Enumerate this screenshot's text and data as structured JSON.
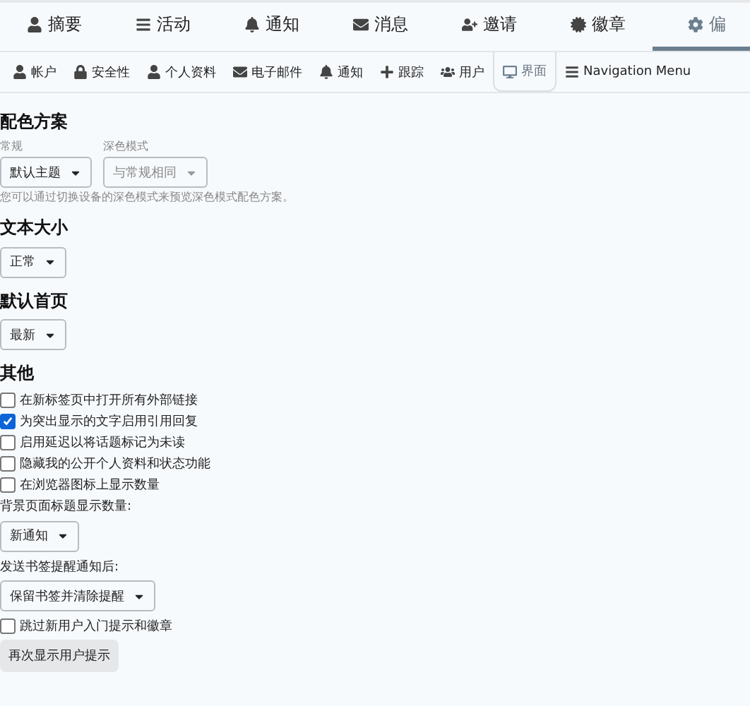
{
  "main_tabs": [
    {
      "label": "摘要",
      "selected": false
    },
    {
      "label": "活动",
      "selected": false
    },
    {
      "label": "通知",
      "selected": false
    },
    {
      "label": "消息",
      "selected": false
    },
    {
      "label": "邀请",
      "selected": false
    },
    {
      "label": "徽章",
      "selected": false
    },
    {
      "label": "偏",
      "selected": true
    }
  ],
  "sub_tabs": [
    {
      "label": "帐户",
      "selected": false
    },
    {
      "label": "安全性",
      "selected": false
    },
    {
      "label": "个人资料",
      "selected": false
    },
    {
      "label": "电子邮件",
      "selected": false
    },
    {
      "label": "通知",
      "selected": false
    },
    {
      "label": "跟踪",
      "selected": false
    },
    {
      "label": "用户",
      "selected": false
    },
    {
      "label": "界面",
      "selected": true
    },
    {
      "label": "Navigation Menu",
      "selected": false
    }
  ],
  "color_scheme": {
    "heading": "配色方案",
    "selects": [
      {
        "label": "常规",
        "value": "默认主题",
        "disabled": false
      },
      {
        "label": "深色模式",
        "value": "与常规相同",
        "disabled": true
      }
    ],
    "note": "您可以通过切换设备的深色模式来预览深色模式配色方案。"
  },
  "text_size": {
    "heading": "文本大小",
    "value": "正常"
  },
  "default_home": {
    "heading": "默认首页",
    "value": "最新"
  },
  "other": {
    "heading": "其他",
    "checkboxes": [
      {
        "label": "在新标签页中打开所有外部链接",
        "checked": false
      },
      {
        "label": "为突出显示的文字启用引用回复",
        "checked": true
      },
      {
        "label": "启用延迟以将话题标记为未读",
        "checked": false
      },
      {
        "label": "隐藏我的公开个人资料和状态功能",
        "checked": false
      },
      {
        "label": "在浏览器图标上显示数量",
        "checked": false
      }
    ],
    "title_count": {
      "label": "背景页面标题显示数量:",
      "value": "新通知"
    },
    "bookmark": {
      "label": "发送书签提醒通知后:",
      "value": "保留书签并清除提醒"
    },
    "skip_checkbox": {
      "label": "跳过新用户入门提示和徽章",
      "checked": false
    },
    "button": "再次显示用户提示"
  }
}
